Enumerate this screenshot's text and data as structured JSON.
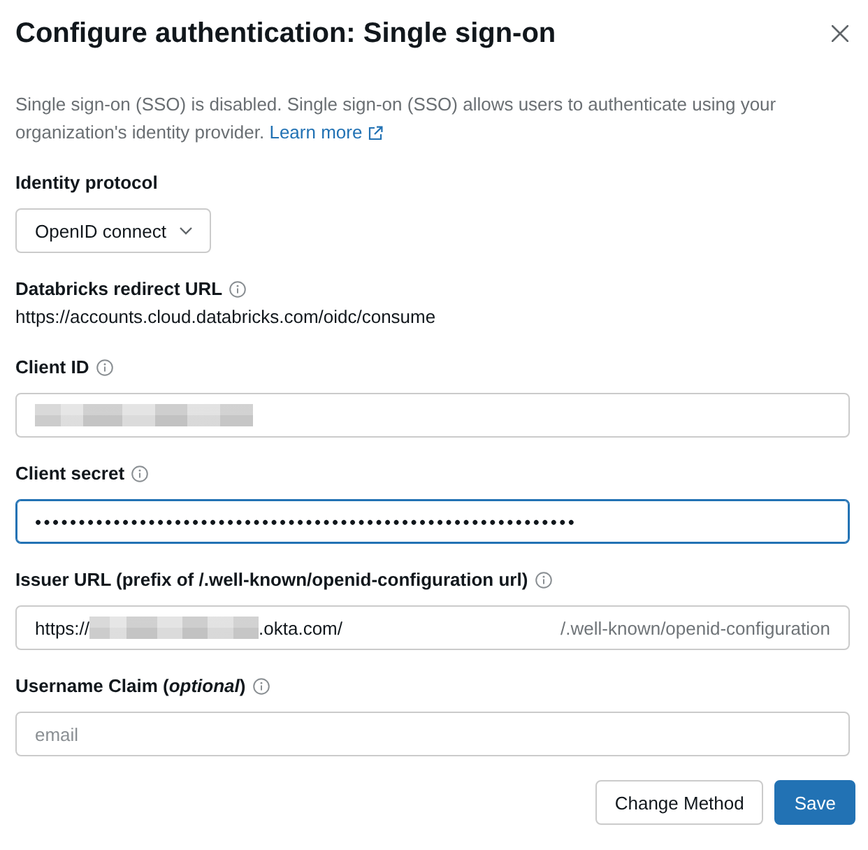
{
  "dialog": {
    "title": "Configure authentication: Single sign-on"
  },
  "description": {
    "text": "Single sign-on (SSO) is disabled. Single sign-on (SSO) allows users to authenticate using your organization's identity provider.",
    "link": "Learn more"
  },
  "identity_protocol": {
    "label": "Identity protocol",
    "value": "OpenID connect"
  },
  "redirect_url": {
    "label": "Databricks redirect URL",
    "info": true,
    "value": "https://accounts.cloud.databricks.com/oidc/consume"
  },
  "fields": [
    {
      "kind": "text",
      "label": "Client ID",
      "info": true,
      "redacted": true,
      "focused": false
    },
    {
      "kind": "text",
      "label": "Client secret",
      "info": true,
      "value": "••••••••••••••••••••••••••••••••••••••••••••••••••••••••••••••",
      "focused": true
    },
    {
      "kind": "url",
      "label": "Issuer URL (prefix of /.well-known/openid-configuration url)",
      "info": true,
      "value_start": "https://",
      "redacted": true,
      "value_end": ".okta.com/",
      "suffix": "/.well-known/openid-configuration",
      "focused": false
    },
    {
      "kind": "text",
      "label": "Username Claim (*optional*)",
      "info": true,
      "placeholder": "email",
      "focused": false
    }
  ],
  "buttons": [
    {
      "label": "Change Method",
      "kind": "secondary"
    },
    {
      "label": "Save",
      "kind": "primary"
    }
  ]
}
